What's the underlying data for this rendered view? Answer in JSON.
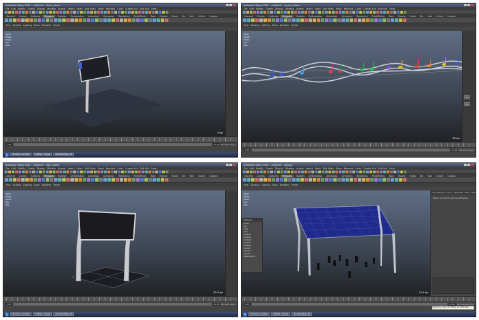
{
  "menu": [
    "File",
    "Edit",
    "Modify",
    "Create",
    "Display",
    "Window",
    "Assets",
    "Select",
    "Mesh",
    "Edit Mesh",
    "Proxy",
    "Normals",
    "Color",
    "Create UVs",
    "Edit UVs",
    "Help"
  ],
  "viewport_menu": [
    "View",
    "Shading",
    "Lighting",
    "Show",
    "Renderer",
    "Panels"
  ],
  "shelf_tabs": [
    "General",
    "Curves",
    "Surfaces",
    "Polygons",
    "Subdivs",
    "Deformation",
    "Animation",
    "Dynamics",
    "Rendering",
    "PaintEffects",
    "Toon",
    "Muscle",
    "Fluids",
    "Fur",
    "Hair",
    "nCloth",
    "Custom"
  ],
  "hud_rows": [
    "Verts:",
    "Edges:",
    "Faces:",
    "Tris:",
    "UVs:"
  ],
  "taskbar_items": [
    "Windows Live Mess",
    "Untitled - Google",
    "Autodesk Maya 20"
  ],
  "panels": [
    {
      "title": "Autodesk Maya 2011 - untitled* - kiosk_stand",
      "fps": "9 fps",
      "active_tab": "Polygons"
    },
    {
      "title": "Autodesk Maya 2011 - untitled* - music_ribbon",
      "fps": "80 fps",
      "active_tab": "Polygons"
    },
    {
      "title": "Autodesk Maya 2011 - untitled* - sign_frame",
      "fps": "22.8 fps",
      "active_tab": "Polygons"
    },
    {
      "title": "Autodesk Maya 2011 - untitled* - canopy",
      "fps": "16.6 fps",
      "active_tab": "Polygons"
    }
  ],
  "outliner": {
    "title": "Outliner",
    "items": [
      "persp",
      "top",
      "front",
      "side",
      "pCube1",
      "pCube2",
      "pCube3",
      "pCube4",
      "pCube5",
      "group1",
      "group2",
      "group3",
      "defaultLight"
    ]
  },
  "attribute_editor": {
    "tabs": [
      "List",
      "Selected",
      "Focus",
      "Attributes",
      "Show",
      "Help"
    ],
    "body": "Select a node to view its attributes."
  },
  "help_line": {
    "title": "Help Line",
    "message": "Select an object to display its attributes."
  },
  "range": {
    "start": "1.00",
    "end": "24.00",
    "label": "No Anim Layer",
    "char": "No Character Set"
  },
  "colors": {
    "viewport_top": "#5f6e86",
    "viewport_bottom": "#202225",
    "ui_dark": "#444444",
    "screen_panel": "#1c1c24",
    "canopy_blue": "#1f2a8c"
  }
}
